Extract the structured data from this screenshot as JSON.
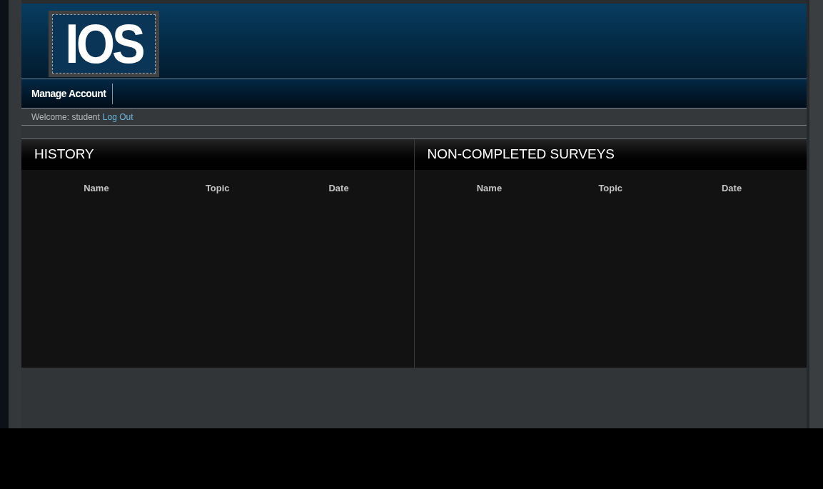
{
  "logo": {
    "text": "IOS"
  },
  "nav": {
    "items": [
      {
        "label": "Manage Account"
      }
    ]
  },
  "welcome": {
    "text": "Welcome: student",
    "link": "Log Out"
  },
  "panels": [
    {
      "title": "HISTORY",
      "columns": [
        "Name",
        "Topic",
        "Date"
      ]
    },
    {
      "title": "NON-COMPLETED SURVEYS",
      "columns": [
        "Name",
        "Topic",
        "Date"
      ]
    }
  ]
}
